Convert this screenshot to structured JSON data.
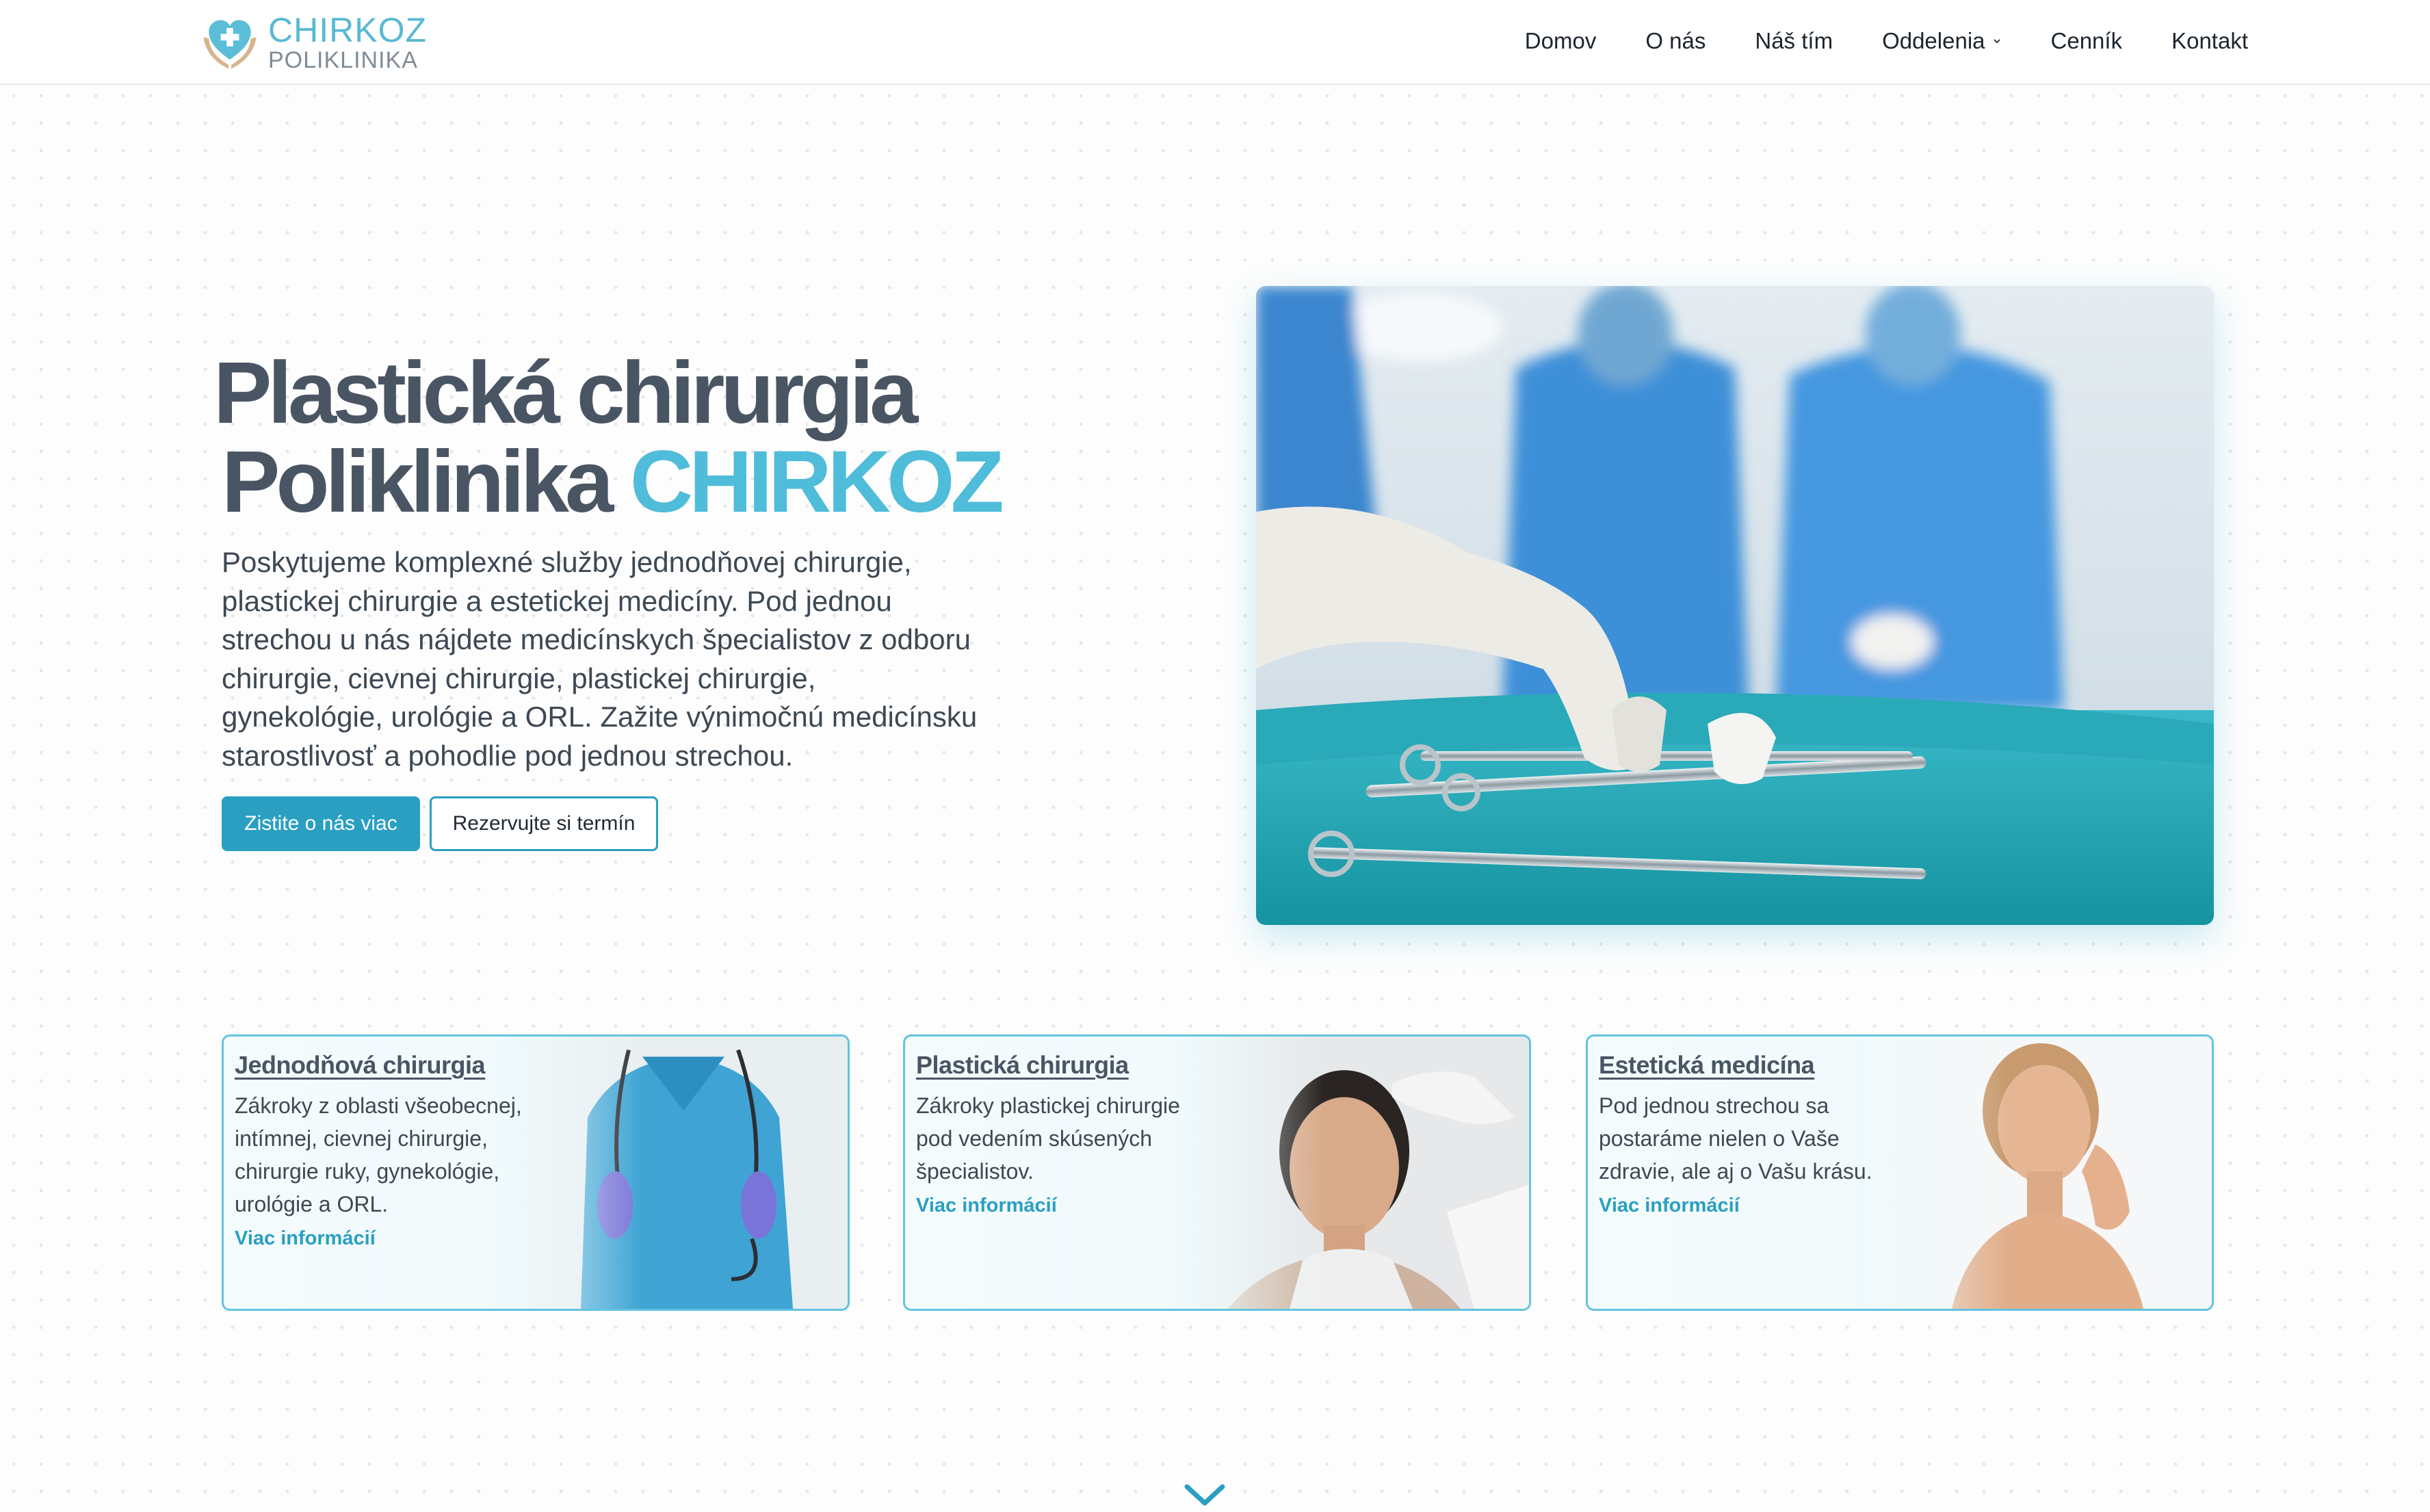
{
  "header": {
    "logo": {
      "name": "CHIRKOZ",
      "subtitle": "POLIKLINIKA",
      "icon": "heart-hands-icon"
    },
    "nav": [
      {
        "label": "Domov"
      },
      {
        "label": "O nás"
      },
      {
        "label": "Náš tím"
      },
      {
        "label": "Oddelenia",
        "has_dropdown": true
      },
      {
        "label": "Cenník"
      },
      {
        "label": "Kontakt"
      }
    ]
  },
  "hero": {
    "title_line1": "Plastická chirurgia",
    "title_line2_prefix": "Poliklinika ",
    "title_line2_accent": "CHIRKOZ",
    "description": "Poskytujeme komplexné služby jednodňovej chirurgie, plastickej chirurgie a estetickej medicíny. Pod jednou strechou u nás nájdete medicínskych špecialistov z odboru chirurgie, cievnej chirurgie, plastickej chirurgie, gynekológie, urológie a ORL. Zažite výnimočnú medicínsku starostlivosť a pohodlie pod jednou strechou.",
    "primary_button": "Zistite o nás viac",
    "secondary_button": "Rezervujte si termín"
  },
  "cards": [
    {
      "title": "Jednodňová chirurgia",
      "text": "Zákroky z oblasti všeobecnej, intímnej, cievnej chirurgie, chirurgie ruky, gynekológie, urológie a ORL.",
      "link": "Viac informácií"
    },
    {
      "title": "Plastická chirurgia",
      "text": "Zákroky plastickej chirurgie pod vedením skúsených špecialistov.",
      "link": "Viac informácií"
    },
    {
      "title": "Estetická medicína",
      "text": "Pod jednou strechou sa postaráme nielen o Vaše zdravie, ale aj o Vašu krásu.",
      "link": "Viac informácií"
    }
  ],
  "colors": {
    "accent": "#4fbcd9",
    "button": "#2a9fc2",
    "heading": "#4a5564",
    "text": "#3d4853"
  }
}
